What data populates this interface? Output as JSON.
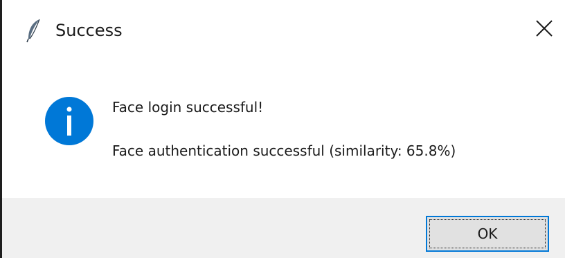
{
  "window": {
    "title": "Success",
    "app_icon": "feather-icon",
    "close_icon": "close-icon"
  },
  "message": {
    "icon": "info-icon",
    "icon_color": "#0078d7",
    "line1": "Face login successful!",
    "line2": "Face authentication successful (similarity: 65.8%)"
  },
  "buttons": {
    "ok_label": "OK",
    "focus_border_color": "#0078d7"
  }
}
